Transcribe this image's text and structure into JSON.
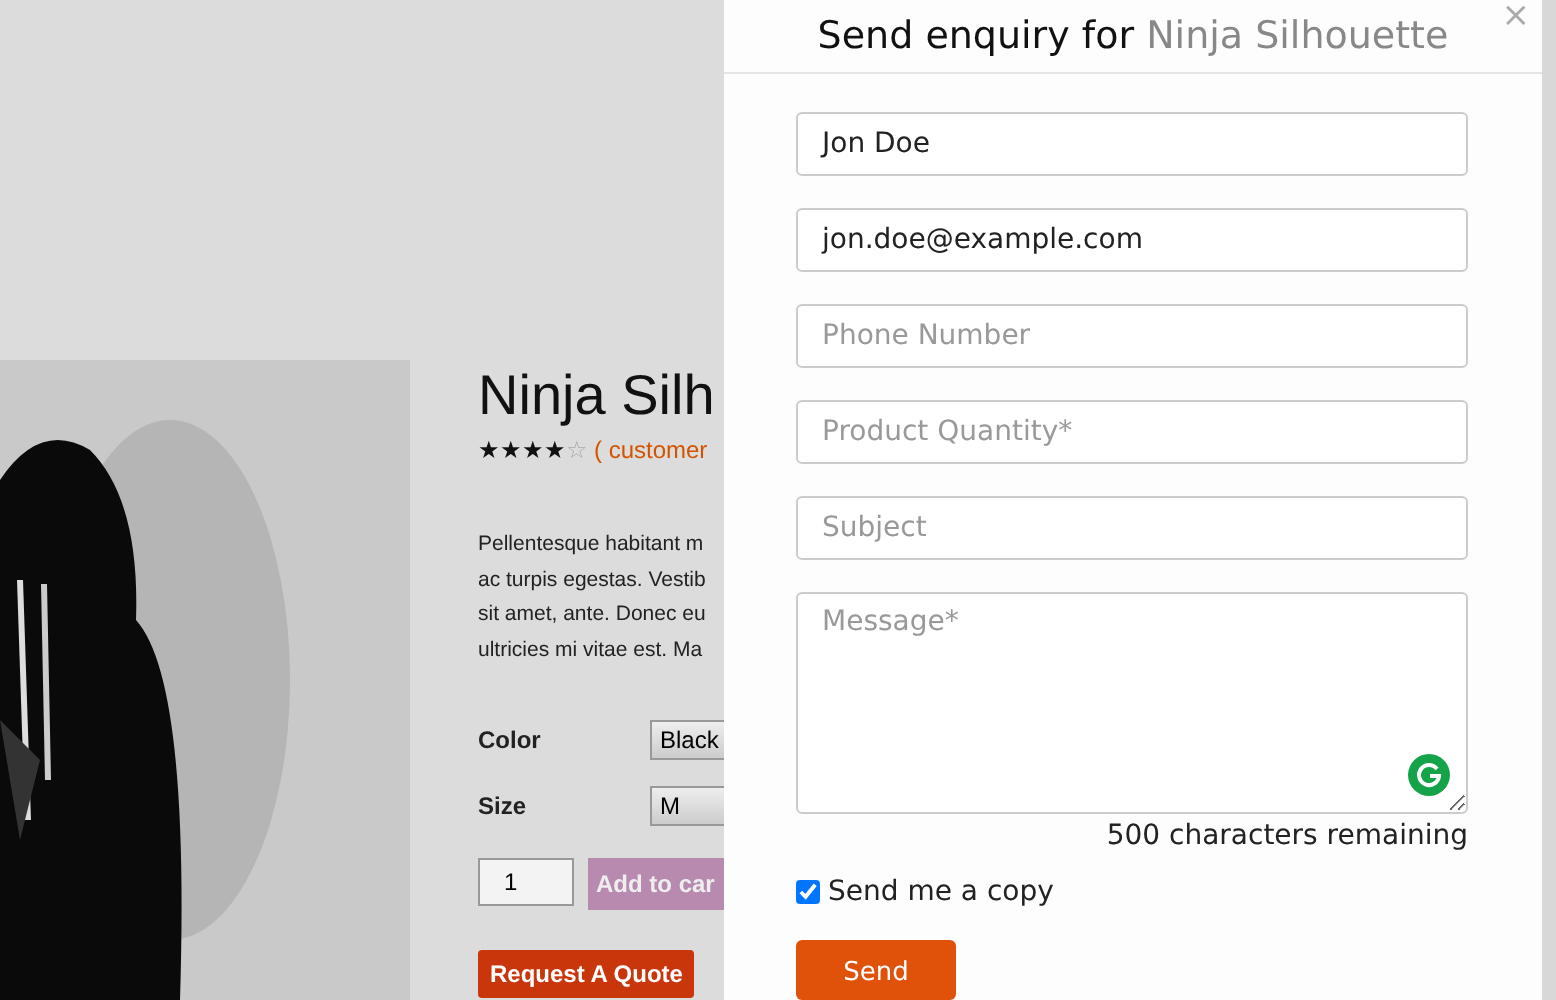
{
  "product": {
    "title": "Ninja Silh",
    "stars": 4,
    "rating_link": "( customer",
    "description_lines": [
      "Pellentesque habitant m",
      "ac turpis egestas. Vestib",
      "sit amet, ante. Donec eu",
      "ultricies mi vitae est. Ma"
    ],
    "options": [
      {
        "label": "Color",
        "value": "Black"
      },
      {
        "label": "Size",
        "value": "M"
      }
    ],
    "quantity": "1",
    "add_to_cart": "Add to car",
    "quote_button": "Request A Quote"
  },
  "modal": {
    "title": "Send enquiry for",
    "product_name": "Ninja Silhouette",
    "close": "×",
    "fields": [
      {
        "value": "Jon Doe"
      },
      {
        "value": "jon.doe@example.com"
      },
      {
        "placeholder": "Phone Number"
      },
      {
        "placeholder": "Product Quantity*"
      },
      {
        "placeholder": "Subject"
      }
    ],
    "message": {
      "placeholder": "Message*"
    },
    "counter": "500 characters remaining",
    "copy": {
      "label": "Send me a copy",
      "checked": true
    },
    "send": "Send"
  }
}
